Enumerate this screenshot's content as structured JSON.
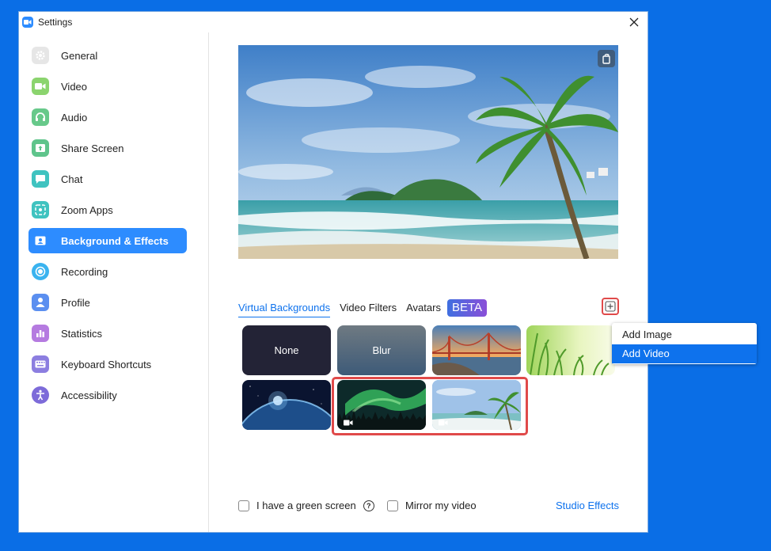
{
  "window": {
    "title": "Settings"
  },
  "sidebar": {
    "items": [
      {
        "label": "General",
        "icon": "gear-icon",
        "color": "#e0e0e0"
      },
      {
        "label": "Video",
        "icon": "video-camera-icon",
        "color": "#8bd46e"
      },
      {
        "label": "Audio",
        "icon": "headphones-icon",
        "color": "#67c98a"
      },
      {
        "label": "Share Screen",
        "icon": "share-screen-icon",
        "color": "#5fc48b"
      },
      {
        "label": "Chat",
        "icon": "chat-bubble-icon",
        "color": "#3fc3c0"
      },
      {
        "label": "Zoom Apps",
        "icon": "apps-icon",
        "color": "#3fc3c0"
      },
      {
        "label": "Background & Effects",
        "icon": "person-portrait-icon",
        "color": "#2d8cff"
      },
      {
        "label": "Recording",
        "icon": "record-icon",
        "color": "#3ab3ef"
      },
      {
        "label": "Profile",
        "icon": "profile-icon",
        "color": "#5b8ff0"
      },
      {
        "label": "Statistics",
        "icon": "bar-chart-icon",
        "color": "#b57be0"
      },
      {
        "label": "Keyboard Shortcuts",
        "icon": "keyboard-icon",
        "color": "#8c7ee0"
      },
      {
        "label": "Accessibility",
        "icon": "accessibility-icon",
        "color": "#7d6bd9"
      }
    ],
    "active_index": 6
  },
  "tabs": {
    "virtual_backgrounds": "Virtual Backgrounds",
    "video_filters": "Video Filters",
    "avatars": "Avatars",
    "beta": "BETA"
  },
  "thumbnails": {
    "none": "None",
    "blur": "Blur"
  },
  "add_menu": {
    "items": [
      "Add Image",
      "Add Video"
    ],
    "selected": "Add Video"
  },
  "bottom": {
    "green_screen": "I have a green screen",
    "help": "?",
    "mirror": "Mirror my video",
    "studio_effects": "Studio Effects"
  },
  "colors": {
    "accent": "#2d8cff",
    "link": "#0e72ed",
    "highlight": "#e04a4a",
    "desktop": "#0a6ee6"
  }
}
